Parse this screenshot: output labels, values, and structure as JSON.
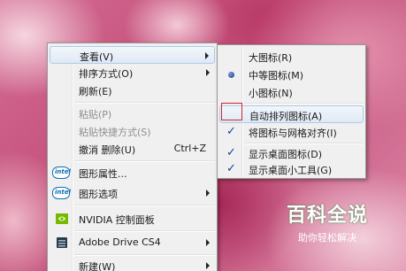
{
  "context_menu": {
    "items": [
      {
        "label": "查看(V)",
        "submenu": true
      },
      {
        "label": "排序方式(O)",
        "submenu": true
      },
      {
        "label": "刷新(E)"
      },
      {
        "label": "粘贴(P)",
        "disabled": true
      },
      {
        "label": "粘贴快捷方式(S)",
        "disabled": true
      },
      {
        "label": "撤消 删除(U)",
        "shortcut": "Ctrl+Z"
      },
      {
        "label": "图形属性...",
        "icon": "intel-icon"
      },
      {
        "label": "图形选项",
        "icon": "intel-icon",
        "submenu": true
      },
      {
        "label": "NVIDIA 控制面板",
        "icon": "nvidia-icon"
      },
      {
        "label": "Adobe Drive CS4",
        "icon": "adobe-drive-icon",
        "submenu": true
      },
      {
        "label": "新建(W)",
        "submenu": true
      }
    ]
  },
  "view_submenu": {
    "items": [
      {
        "label": "大图标(R)"
      },
      {
        "label": "中等图标(M)",
        "selected": true
      },
      {
        "label": "小图标(N)"
      },
      {
        "label": "自动排列图标(A)",
        "checked": false,
        "highlighted": true
      },
      {
        "label": "将图标与网格对齐(I)",
        "checked": true
      },
      {
        "label": "显示桌面图标(D)",
        "checked": true
      },
      {
        "label": "显示桌面小工具(G)",
        "checked": true
      }
    ]
  },
  "icon_text": {
    "intel": "intel"
  },
  "watermark": {
    "logo": "百科全说",
    "subtitle": "助你轻松解决"
  },
  "colors": {
    "check": "#1b3f9b",
    "highlight_border": "#aecbe7",
    "red_box": "#d1242f",
    "watermark_green": "#2fa34a"
  }
}
